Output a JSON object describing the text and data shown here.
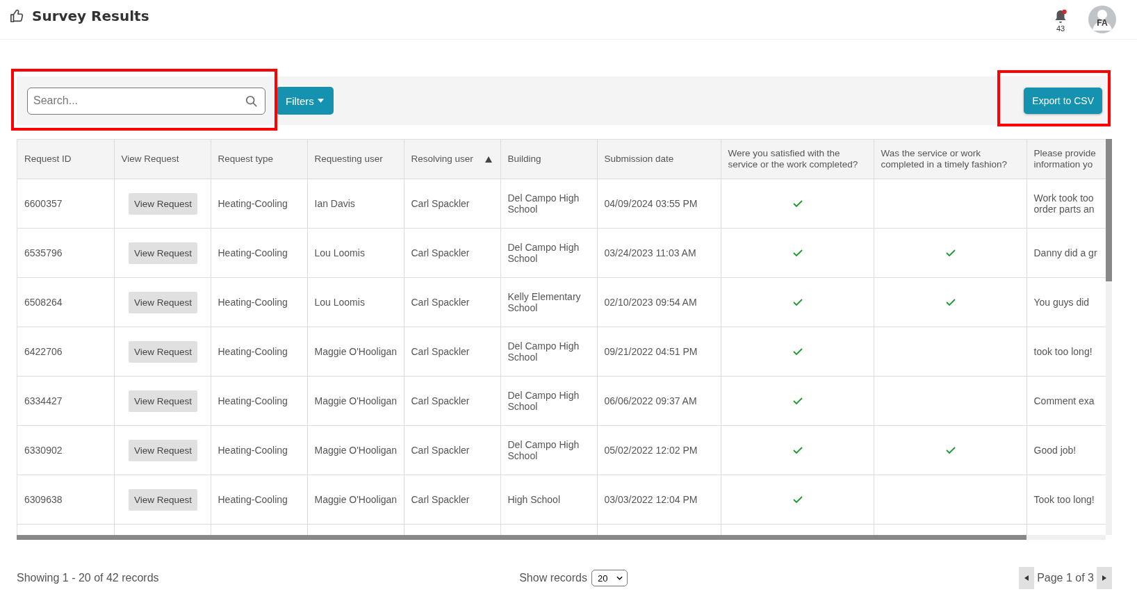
{
  "header": {
    "title": "Survey Results",
    "notifications": {
      "count": "43",
      "unread": true
    },
    "avatar": {
      "initials": "FA"
    }
  },
  "toolbar": {
    "search": {
      "placeholder": "Search...",
      "highlighted": true
    },
    "filters_button": "Filters",
    "export_button": {
      "label": "Export to CSV",
      "highlighted": true
    }
  },
  "table": {
    "columns": [
      {
        "label": "Request ID",
        "sorted": false
      },
      {
        "label": "View Request",
        "sorted": false
      },
      {
        "label": "Request type",
        "sorted": false
      },
      {
        "label": "Requesting user",
        "sorted": false
      },
      {
        "label": "Resolving user",
        "sorted": true
      },
      {
        "label": "Building",
        "sorted": false
      },
      {
        "label": "Submission date",
        "sorted": false
      },
      {
        "label": "Were you satisfied with the service or the work completed?",
        "sorted": false
      },
      {
        "label": "Was the service or work completed in a timely fashion?",
        "sorted": false
      },
      {
        "label": "Please provide information yo",
        "sorted": false
      }
    ],
    "rows": [
      {
        "request_id": "6600357",
        "view_button": "View Request",
        "request_type": "Heating-Cooling",
        "requesting_user": "Ian Davis",
        "resolving_user": "Carl Spackler",
        "building": "Del Campo High School",
        "submission_date": "04/09/2024 03:55 PM",
        "satisfied": true,
        "timely": false,
        "comment": "Work took too order parts an"
      },
      {
        "request_id": "6535796",
        "view_button": "View Request",
        "request_type": "Heating-Cooling",
        "requesting_user": "Lou Loomis",
        "resolving_user": "Carl Spackler",
        "building": "Del Campo High School",
        "submission_date": "03/24/2023 11:03 AM",
        "satisfied": true,
        "timely": true,
        "comment": "Danny did a gr"
      },
      {
        "request_id": "6508264",
        "view_button": "View Request",
        "request_type": "Heating-Cooling",
        "requesting_user": "Lou Loomis",
        "resolving_user": "Carl Spackler",
        "building": "Kelly Elementary School",
        "submission_date": "02/10/2023 09:54 AM",
        "satisfied": true,
        "timely": true,
        "comment": "You guys did"
      },
      {
        "request_id": "6422706",
        "view_button": "View Request",
        "request_type": "Heating-Cooling",
        "requesting_user": "Maggie O'Hooligan",
        "resolving_user": "Carl Spackler",
        "building": "Del Campo High School",
        "submission_date": "09/21/2022 04:51 PM",
        "satisfied": true,
        "timely": false,
        "comment": "took too long!"
      },
      {
        "request_id": "6334427",
        "view_button": "View Request",
        "request_type": "Heating-Cooling",
        "requesting_user": "Maggie O'Hooligan",
        "resolving_user": "Carl Spackler",
        "building": "Del Campo High School",
        "submission_date": "06/06/2022 09:37 AM",
        "satisfied": true,
        "timely": false,
        "comment": "Comment exa"
      },
      {
        "request_id": "6330902",
        "view_button": "View Request",
        "request_type": "Heating-Cooling",
        "requesting_user": "Maggie O'Hooligan",
        "resolving_user": "Carl Spackler",
        "building": "Del Campo High School",
        "submission_date": "05/02/2022 12:02 PM",
        "satisfied": true,
        "timely": true,
        "comment": "Good job!"
      },
      {
        "request_id": "6309638",
        "view_button": "View Request",
        "request_type": "Heating-Cooling",
        "requesting_user": "Maggie O'Hooligan",
        "resolving_user": "Carl Spackler",
        "building": "High School",
        "submission_date": "03/03/2022 12:04 PM",
        "satisfied": true,
        "timely": false,
        "comment": "Took too long!"
      }
    ]
  },
  "footer": {
    "summary": "Showing 1 - 20 of 42 records",
    "show_records_label": "Show records",
    "show_records_value": "20",
    "page_label": "Page 1 of 3"
  }
}
